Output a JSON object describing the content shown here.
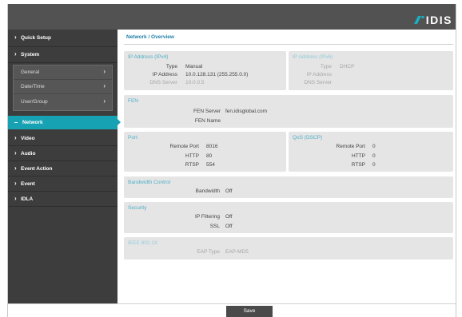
{
  "header": {
    "logo_text": "IDIS",
    "logo_icon": "idis-logo-mark-icon"
  },
  "colors": {
    "header": "#525252",
    "sidebar": "#3d3d3d",
    "accent": "#17a2b3",
    "title": "#1e7fa8",
    "section_heading": "#4fb0c8",
    "section_bg": "#e5e5e5",
    "button": "#4a4a4a"
  },
  "sidebar": {
    "items": [
      {
        "label": "Quick Setup",
        "icon": "chevron-right-icon"
      },
      {
        "label": "System",
        "icon": "chevron-right-icon",
        "expanded": true,
        "children": [
          {
            "label": "General",
            "icon": "chevron-right-icon"
          },
          {
            "label": "Date/Time",
            "icon": "chevron-right-icon"
          },
          {
            "label": "User/Group",
            "icon": "chevron-right-icon"
          }
        ]
      },
      {
        "label": "Network",
        "icon": "minus-icon",
        "active": true
      },
      {
        "label": "Video",
        "icon": "chevron-right-icon"
      },
      {
        "label": "Audio",
        "icon": "chevron-right-icon"
      },
      {
        "label": "Event Action",
        "icon": "chevron-right-icon"
      },
      {
        "label": "Event",
        "icon": "chevron-right-icon"
      },
      {
        "label": "IDLA",
        "icon": "chevron-right-icon"
      }
    ]
  },
  "main": {
    "breadcrumb": "Network / Overview",
    "ipv4": {
      "heading": "IP Address (IPv4)",
      "rows": [
        {
          "label": "Type",
          "value": "Manual"
        },
        {
          "label": "IP Address",
          "value": "10.0.128.131 (255.255.0.0)"
        },
        {
          "label": "DNS Server",
          "value": "10.0.0.5",
          "enabled": false
        }
      ]
    },
    "ipv6": {
      "heading": "IP Address (IPv6)",
      "enabled": false,
      "rows": [
        {
          "label": "Type",
          "value": "DHCP"
        },
        {
          "label": "IP Address"
        },
        {
          "label": "DNS Server"
        }
      ]
    },
    "fen": {
      "heading": "FEN",
      "rows": [
        {
          "label": "FEN Server",
          "value": "fen.idisglobal.com"
        },
        {
          "label": "FEN Name"
        }
      ]
    },
    "port": {
      "heading": "Port",
      "rows": [
        {
          "label": "Remote Port",
          "value": "8016"
        },
        {
          "label": "HTTP",
          "value": "80"
        },
        {
          "label": "RTSP",
          "value": "554"
        }
      ]
    },
    "qos": {
      "heading": "QoS (DSCP)",
      "rows": [
        {
          "label": "Remote Port",
          "value": "0"
        },
        {
          "label": "HTTP",
          "value": "0"
        },
        {
          "label": "RTSP",
          "value": "0"
        }
      ]
    },
    "bandwidth": {
      "heading": "Bandwidth Control",
      "rows": [
        {
          "label": "Bandwidth",
          "value": "Off"
        }
      ]
    },
    "security": {
      "heading": "Security",
      "rows": [
        {
          "label": "IP Filtering",
          "value": "Off"
        },
        {
          "label": "SSL",
          "value": "Off"
        }
      ]
    },
    "ieee8021x": {
      "heading": "IEEE 802.1X",
      "enabled": false,
      "rows": [
        {
          "label": "EAP Type",
          "value": "EAP-MD5"
        }
      ]
    }
  },
  "footer": {
    "save_label": "Save"
  }
}
